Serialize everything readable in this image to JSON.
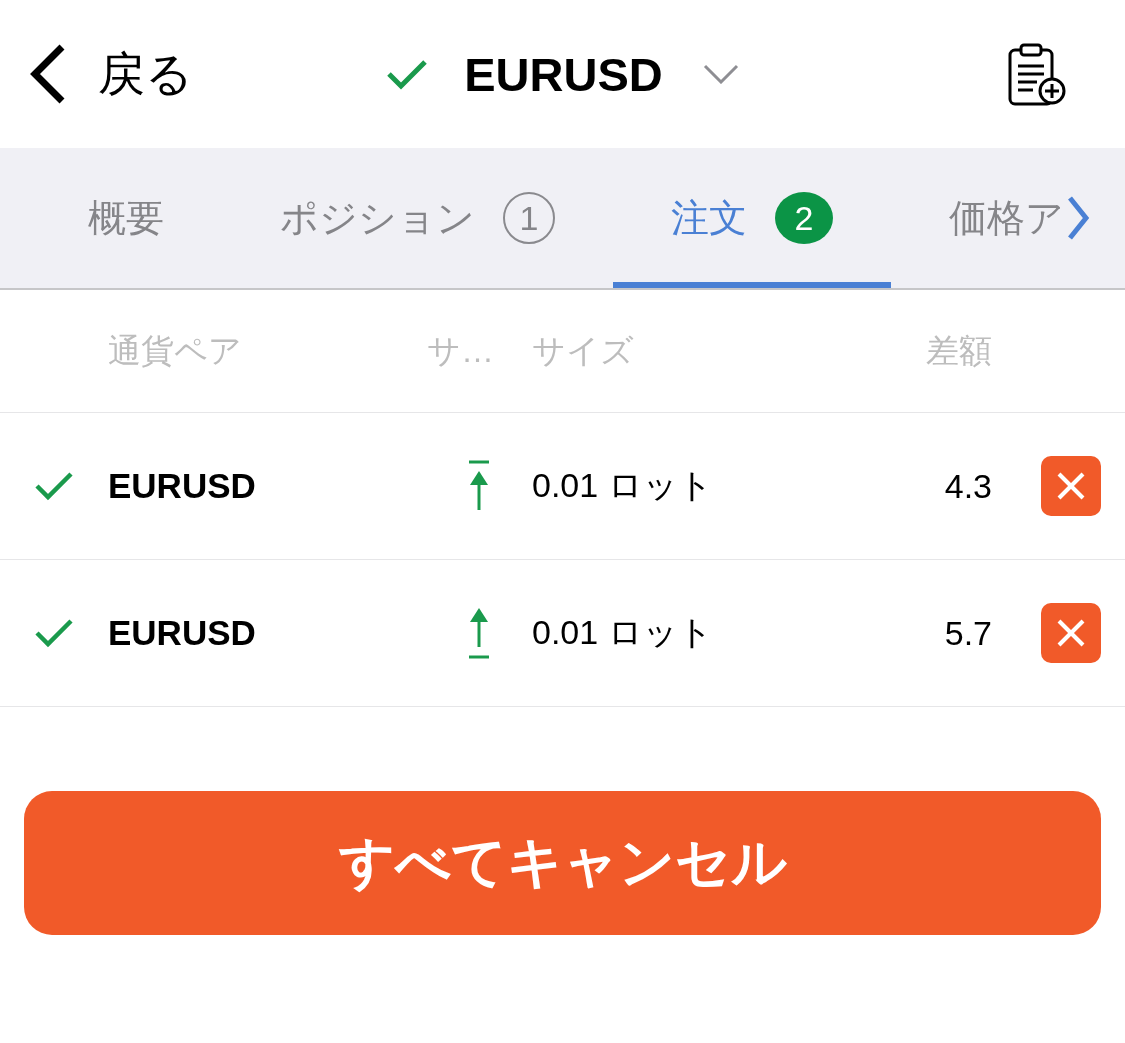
{
  "header": {
    "back_label": "戻る",
    "symbol": "EURUSD"
  },
  "tabs": [
    {
      "label": "概要",
      "selected": false
    },
    {
      "label": "ポジション",
      "badge": "1",
      "selected": false
    },
    {
      "label": "注文",
      "badge": "2",
      "selected": true
    },
    {
      "label": "価格ア",
      "selected": false
    }
  ],
  "columns": [
    "通貨ペア",
    "サ…",
    "サイズ",
    "差額"
  ],
  "orders": [
    {
      "symbol": "EURUSD",
      "kind": "overline",
      "size": "0.01 ロット",
      "difference": "4.3"
    },
    {
      "symbol": "EURUSD",
      "kind": "underline",
      "size": "0.01 ロット",
      "difference": "5.7"
    }
  ],
  "cancel_all_button": "すべてキャンセル"
}
